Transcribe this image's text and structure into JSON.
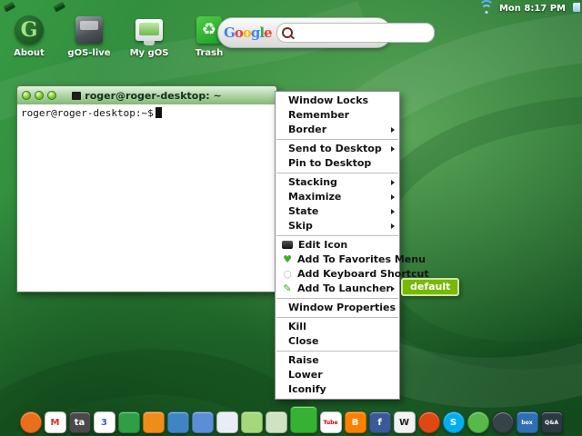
{
  "theme": {
    "desktop_green": "#2a7d35",
    "menu_highlight_green": "#76b900",
    "titlebar_green": "#a6cf9b"
  },
  "topbar": {
    "clock": "Mon 8:17 PM"
  },
  "desktop_icons": [
    {
      "label": "About"
    },
    {
      "label": "gOS-live"
    },
    {
      "label": "My gOS"
    },
    {
      "label": "Trash"
    }
  ],
  "search": {
    "logo_letters": [
      {
        "ch": "G",
        "color": "#4285f4"
      },
      {
        "ch": "o",
        "color": "#ea4335"
      },
      {
        "ch": "o",
        "color": "#fbbc05"
      },
      {
        "ch": "g",
        "color": "#4285f4"
      },
      {
        "ch": "l",
        "color": "#34a853"
      },
      {
        "ch": "e",
        "color": "#ea4335"
      }
    ],
    "value": "",
    "placeholder": ""
  },
  "terminal": {
    "title": "roger@roger-desktop: ~",
    "prompt": "roger@roger-desktop:~$"
  },
  "context_menu": {
    "groups": [
      {
        "items": [
          {
            "label": "Window Locks"
          },
          {
            "label": "Remember"
          },
          {
            "label": "Border",
            "submenu": true
          }
        ]
      },
      {
        "items": [
          {
            "label": "Send to Desktop",
            "submenu": true
          },
          {
            "label": "Pin to Desktop"
          }
        ]
      },
      {
        "items": [
          {
            "label": "Stacking",
            "submenu": true
          },
          {
            "label": "Maximize",
            "submenu": true
          },
          {
            "label": "State",
            "submenu": true
          },
          {
            "label": "Skip",
            "submenu": true
          }
        ]
      },
      {
        "items": [
          {
            "label": "Edit Icon",
            "icon": "edit"
          },
          {
            "label": "Add To Favorites Menu",
            "icon": "favorites"
          },
          {
            "label": "Add Keyboard Shortcut",
            "icon": "keyboard"
          },
          {
            "label": "Add To Launcher",
            "submenu": true,
            "icon": "launcher"
          }
        ]
      },
      {
        "items": [
          {
            "label": "Window Properties"
          }
        ]
      },
      {
        "items": [
          {
            "label": "Kill"
          },
          {
            "label": "Close"
          }
        ]
      },
      {
        "items": [
          {
            "label": "Raise"
          },
          {
            "label": "Lower"
          },
          {
            "label": "Iconify"
          }
        ]
      }
    ],
    "submenu_item": "default"
  },
  "dock": {
    "items": [
      {
        "name": "firefox",
        "color": "#e8701a",
        "text": "",
        "fg": "#ffffff",
        "shape": "circle"
      },
      {
        "name": "gmail",
        "color": "#ffffff",
        "text": "M",
        "fg": "#d93025",
        "shape": "square"
      },
      {
        "name": "meebo",
        "color": "#4a4a4a",
        "text": "ta",
        "fg": "#ffffff",
        "shape": "square"
      },
      {
        "name": "calendar",
        "color": "#ffffff",
        "text": "3",
        "fg": "#3a66b0",
        "shape": "square"
      },
      {
        "name": "docs-green",
        "color": "#2f9e44",
        "text": "",
        "fg": "#ffffff",
        "shape": "square"
      },
      {
        "name": "reader",
        "color": "#f08c1a",
        "text": "",
        "fg": "#ffffff",
        "shape": "square"
      },
      {
        "name": "talk",
        "color": "#3f85c6",
        "text": "",
        "fg": "#ffffff",
        "shape": "square"
      },
      {
        "name": "folders",
        "color": "#5b8ed6",
        "text": "",
        "fg": "#ffffff",
        "shape": "square"
      },
      {
        "name": "document",
        "color": "#e8eef5",
        "text": "",
        "fg": "#3a66b0",
        "shape": "square"
      },
      {
        "name": "notes",
        "color": "#a6d77b",
        "text": "",
        "fg": "#ffffff",
        "shape": "square"
      },
      {
        "name": "faded-app",
        "color": "#cfe3c2",
        "text": "",
        "fg": "#ffffff",
        "shape": "square"
      },
      {
        "name": "gos-leaf",
        "color": "#35b234",
        "text": "",
        "fg": "#ffffff",
        "shape": "square",
        "size": 30
      },
      {
        "name": "youtube",
        "color": "#ffffff",
        "text": "Tube",
        "fg": "#cc0000",
        "shape": "square"
      },
      {
        "name": "blogger",
        "color": "#ff8000",
        "text": "B",
        "fg": "#ffffff",
        "shape": "square"
      },
      {
        "name": "facebook",
        "color": "#3b5998",
        "text": "f",
        "fg": "#ffffff",
        "shape": "square"
      },
      {
        "name": "wikipedia",
        "color": "#f2f2f2",
        "text": "W",
        "fg": "#222222",
        "shape": "square"
      },
      {
        "name": "ubuntu",
        "color": "#dd4814",
        "text": "",
        "fg": "#ffffff",
        "shape": "circle"
      },
      {
        "name": "skype",
        "color": "#00aff0",
        "text": "S",
        "fg": "#ffffff",
        "shape": "circle"
      },
      {
        "name": "evergreen",
        "color": "#57b947",
        "text": "",
        "fg": "#ffffff",
        "shape": "circle"
      },
      {
        "name": "dark-app",
        "color": "#37424a",
        "text": "",
        "fg": "#ffffff",
        "shape": "circle"
      },
      {
        "name": "box",
        "color": "#2f6fb3",
        "text": "box",
        "fg": "#ffffff",
        "shape": "square"
      },
      {
        "name": "qa",
        "color": "#2b3a42",
        "text": "Q&A",
        "fg": "#ffffff",
        "shape": "square"
      }
    ]
  }
}
